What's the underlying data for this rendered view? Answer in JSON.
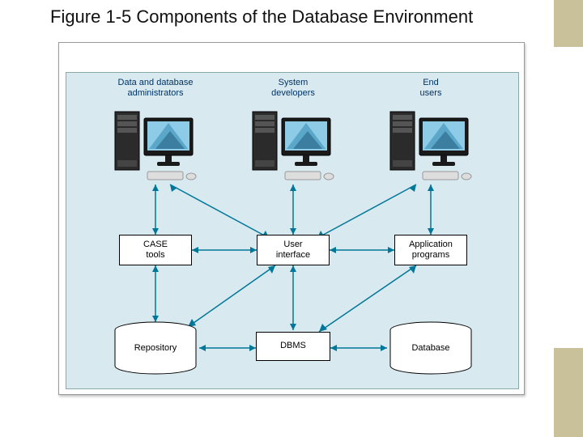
{
  "title": "Figure 1-5 Components of the Database Environment",
  "headers": {
    "admins": "Data and database\nadministrators",
    "sysdev": "System\ndevelopers",
    "endusers": "End\nusers"
  },
  "row2": {
    "case_tools": "CASE\ntools",
    "user_interface": "User\ninterface",
    "app_programs": "Application\nprograms"
  },
  "row3": {
    "repository": "Repository",
    "dbms": "DBMS",
    "database": "Database"
  },
  "diagram_structure": {
    "nodes": [
      {
        "id": "admins",
        "type": "workstation-with-label",
        "row": 1,
        "col": 1
      },
      {
        "id": "sysdev",
        "type": "workstation-with-label",
        "row": 1,
        "col": 2
      },
      {
        "id": "endusers",
        "type": "workstation-with-label",
        "row": 1,
        "col": 3
      },
      {
        "id": "case_tools",
        "type": "box",
        "row": 2,
        "col": 1
      },
      {
        "id": "user_interface",
        "type": "box",
        "row": 2,
        "col": 2
      },
      {
        "id": "app_programs",
        "type": "box",
        "row": 2,
        "col": 3
      },
      {
        "id": "repository",
        "type": "cylinder",
        "row": 3,
        "col": 1
      },
      {
        "id": "dbms",
        "type": "box",
        "row": 3,
        "col": 2
      },
      {
        "id": "database",
        "type": "cylinder",
        "row": 3,
        "col": 3
      }
    ],
    "edges": [
      {
        "from": "admins",
        "to": "case_tools",
        "dir": "both"
      },
      {
        "from": "admins",
        "to": "user_interface",
        "dir": "both"
      },
      {
        "from": "sysdev",
        "to": "user_interface",
        "dir": "both"
      },
      {
        "from": "endusers",
        "to": "user_interface",
        "dir": "both"
      },
      {
        "from": "endusers",
        "to": "app_programs",
        "dir": "both"
      },
      {
        "from": "case_tools",
        "to": "repository",
        "dir": "both"
      },
      {
        "from": "case_tools",
        "to": "user_interface",
        "dir": "both"
      },
      {
        "from": "user_interface",
        "to": "app_programs",
        "dir": "both"
      },
      {
        "from": "user_interface",
        "to": "repository",
        "dir": "both"
      },
      {
        "from": "user_interface",
        "to": "dbms",
        "dir": "both"
      },
      {
        "from": "app_programs",
        "to": "dbms",
        "dir": "both"
      },
      {
        "from": "repository",
        "to": "dbms",
        "dir": "both"
      },
      {
        "from": "dbms",
        "to": "database",
        "dir": "both"
      }
    ]
  }
}
